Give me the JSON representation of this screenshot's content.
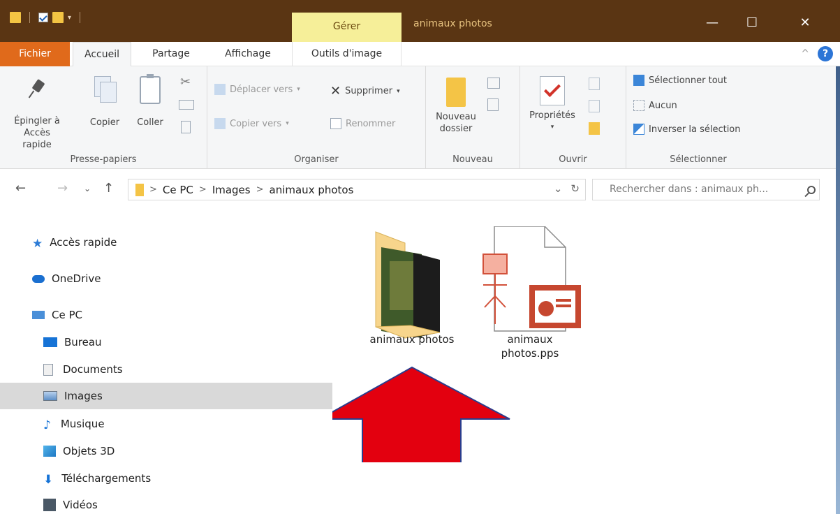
{
  "window": {
    "title": "animaux photos",
    "contextual_tab_group": "Gérer",
    "minimize": "—",
    "maximize": "☐",
    "close": "✕"
  },
  "tabs": {
    "file": "Fichier",
    "home": "Accueil",
    "share": "Partage",
    "view": "Affichage",
    "picture_tools": "Outils d'image",
    "collapse": "^",
    "help": "?"
  },
  "ribbon": {
    "clipboard": {
      "pin_line1": "Épingler à",
      "pin_line2": "Accès rapide",
      "copy": "Copier",
      "paste": "Coller",
      "label": "Presse-papiers"
    },
    "organize": {
      "move_to": "Déplacer vers",
      "copy_to": "Copier vers",
      "delete": "Supprimer",
      "rename": "Renommer",
      "label": "Organiser"
    },
    "new": {
      "new_folder_line1": "Nouveau",
      "new_folder_line2": "dossier",
      "label": "Nouveau"
    },
    "open": {
      "properties": "Propriétés",
      "label": "Ouvrir"
    },
    "select": {
      "select_all": "Sélectionner tout",
      "select_none": "Aucun",
      "invert": "Inverser la sélection",
      "label": "Sélectionner"
    }
  },
  "address": {
    "crumbs": [
      "Ce PC",
      "Images",
      "animaux photos"
    ],
    "search_placeholder": "Rechercher dans : animaux ph..."
  },
  "sidebar": {
    "items": [
      {
        "label": "Accès rapide",
        "icon": "star-icon"
      },
      {
        "label": "OneDrive",
        "icon": "cloud-icon"
      },
      {
        "label": "Ce PC",
        "icon": "computer-icon"
      },
      {
        "label": "Bureau",
        "icon": "desktop-icon"
      },
      {
        "label": "Documents",
        "icon": "documents-icon"
      },
      {
        "label": "Images",
        "icon": "images-icon",
        "selected": true
      },
      {
        "label": "Musique",
        "icon": "music-icon"
      },
      {
        "label": "Objets 3D",
        "icon": "objects-3d-icon"
      },
      {
        "label": "Téléchargements",
        "icon": "downloads-icon"
      },
      {
        "label": "Vidéos",
        "icon": "videos-icon"
      }
    ]
  },
  "files": [
    {
      "name": "animaux photos",
      "type": "folder"
    },
    {
      "name_line1": "animaux",
      "name_line2": "photos.pps",
      "type": "pps"
    }
  ],
  "colors": {
    "titlebar": "#5a3513",
    "file_tab": "#e06a1b",
    "gerer": "#f6ef99",
    "arrow": "#e3000f"
  }
}
